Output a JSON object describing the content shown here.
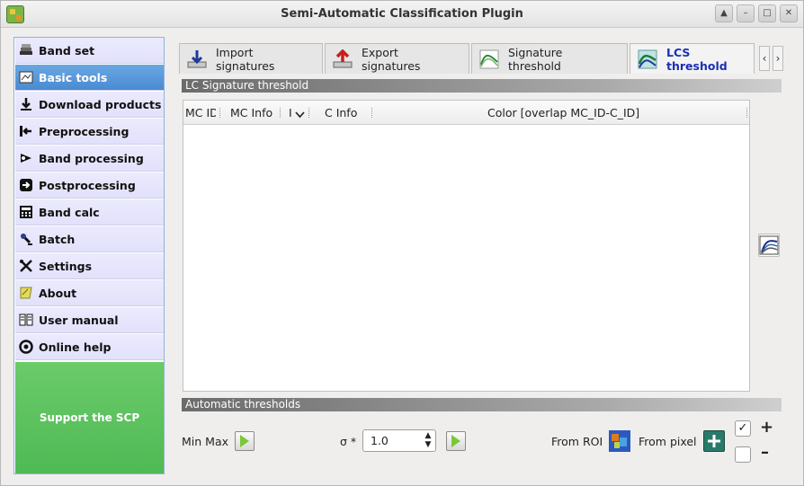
{
  "window": {
    "title": "Semi-Automatic Classification Plugin",
    "controls": [
      "▲",
      "–",
      "□",
      "✕"
    ]
  },
  "sidebar": {
    "items": [
      {
        "label": "Band set",
        "icon": "band-set-icon"
      },
      {
        "label": "Basic tools",
        "icon": "basic-tools-icon",
        "active": true
      },
      {
        "label": "Download products",
        "icon": "download-icon"
      },
      {
        "label": "Preprocessing",
        "icon": "preprocessing-icon"
      },
      {
        "label": "Band processing",
        "icon": "band-processing-icon"
      },
      {
        "label": "Postprocessing",
        "icon": "postprocessing-icon"
      },
      {
        "label": "Band calc",
        "icon": "calculator-icon"
      },
      {
        "label": "Batch",
        "icon": "batch-icon"
      },
      {
        "label": "Settings",
        "icon": "settings-icon"
      },
      {
        "label": "About",
        "icon": "about-icon"
      },
      {
        "label": "User manual",
        "icon": "manual-icon"
      },
      {
        "label": "Online help",
        "icon": "help-icon"
      }
    ],
    "support_label": "Support the SCP"
  },
  "tabs": [
    {
      "label": "Import signatures",
      "icon": "import-icon"
    },
    {
      "label": "Export signatures",
      "icon": "export-icon"
    },
    {
      "label": "Signature threshold",
      "icon": "threshold-icon"
    },
    {
      "label": "LCS threshold",
      "icon": "lcs-icon",
      "active": true
    }
  ],
  "tab_scroll": {
    "left": "‹",
    "right": "›"
  },
  "lc_section": {
    "title": "LC Signature threshold",
    "columns": [
      "MC ID",
      "MC Info",
      "I",
      "C Info",
      "Color [overlap MC_ID-C_ID]"
    ],
    "rows": []
  },
  "auto_section": {
    "title": "Automatic  thresholds",
    "min_max_label": "Min Max",
    "sigma_label": "σ *",
    "sigma_value": "1.0",
    "from_roi_label": "From ROI",
    "from_pixel_label": "From pixel"
  },
  "colors": {
    "sidebar_active": "#4a8ad2",
    "sidebar_item": "#e6e5fc",
    "support": "#56bf5a",
    "active_tab_text": "#1a2fb3"
  }
}
